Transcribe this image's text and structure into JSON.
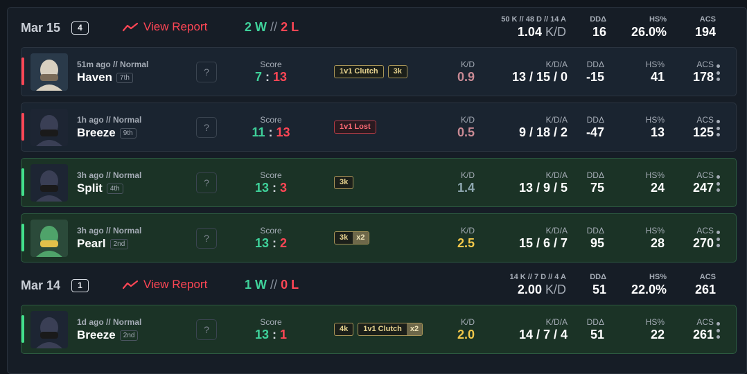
{
  "colors": {
    "win": "#3fd19a",
    "loss": "#ff4655",
    "neutral_kd": "#8ea7b0",
    "gold_kd": "#f2c84b",
    "bad_kd": "#c98a94"
  },
  "days": [
    {
      "date": "Mar 15",
      "count": "4",
      "view_report": "View Report",
      "wins": "2 W",
      "sep": "//",
      "losses": "2 L",
      "kda_summary": "50 K // 48 D // 14 A",
      "kd_value": "1.04",
      "kd_unit": "K/D",
      "dd_label": "DDΔ",
      "dd": "16",
      "hs_label": "HS%",
      "hs": "26.0%",
      "acs_label": "ACS",
      "acs": "194"
    },
    {
      "date": "Mar 14",
      "count": "1",
      "view_report": "View Report",
      "wins": "1 W",
      "sep": "//",
      "losses": "0 L",
      "kda_summary": "14 K // 7 D // 4 A",
      "kd_value": "2.00",
      "kd_unit": "K/D",
      "dd_label": "DDΔ",
      "dd": "51",
      "hs_label": "HS%",
      "hs": "22.0%",
      "acs_label": "ACS",
      "acs": "261"
    }
  ],
  "labels": {
    "score": "Score",
    "kd": "K/D",
    "kda": "K/D/A",
    "dd": "DDΔ",
    "hs": "HS%",
    "acs": "ACS",
    "question": "?"
  },
  "matches": [
    {
      "result": "loss",
      "agent_icon": "agent-portrait-icon",
      "ago": "51m ago // Normal",
      "map": "Haven",
      "place": "7th",
      "score_a": "7",
      "score_b": "13",
      "score_sep": ":",
      "tags": [
        {
          "text": "1v1 Clutch"
        },
        {
          "text": "3k"
        }
      ],
      "kd": "0.9",
      "kd_color": "#c98a94",
      "kda": "13 / 15 / 0",
      "dd": "-15",
      "hs": "41",
      "acs": "178"
    },
    {
      "result": "loss",
      "agent_icon": "agent-portrait-icon",
      "ago": "1h ago // Normal",
      "map": "Breeze",
      "place": "9th",
      "score_a": "11",
      "score_b": "13",
      "score_sep": ":",
      "tags": [
        {
          "text": "1v1 Lost",
          "lost": true
        }
      ],
      "kd": "0.5",
      "kd_color": "#c98a94",
      "kda": "9 / 18 / 2",
      "dd": "-47",
      "hs": "13",
      "acs": "125"
    },
    {
      "result": "win",
      "agent_icon": "agent-portrait-icon",
      "ago": "3h ago // Normal",
      "map": "Split",
      "place": "4th",
      "score_a": "13",
      "score_b": "3",
      "score_sep": ":",
      "tags": [
        {
          "text": "3k"
        }
      ],
      "kd": "1.4",
      "kd_color": "#8ea7b0",
      "kda": "13 / 9 / 5",
      "dd": "75",
      "hs": "24",
      "acs": "247"
    },
    {
      "result": "win",
      "agent_icon": "agent-portrait-icon",
      "ago": "3h ago // Normal",
      "map": "Pearl",
      "place": "2nd",
      "score_a": "13",
      "score_b": "2",
      "score_sep": ":",
      "tags": [
        {
          "text": "3k",
          "mult": "x2"
        }
      ],
      "kd": "2.5",
      "kd_color": "#f2c84b",
      "kda": "15 / 6 / 7",
      "dd": "95",
      "hs": "28",
      "acs": "270"
    },
    {
      "result": "win",
      "agent_icon": "agent-portrait-icon",
      "ago": "1d ago // Normal",
      "map": "Breeze",
      "place": "2nd",
      "score_a": "13",
      "score_b": "1",
      "score_sep": ":",
      "tags": [
        {
          "text": "4k"
        },
        {
          "text": "1v1 Clutch",
          "mult": "x2"
        }
      ],
      "kd": "2.0",
      "kd_color": "#f2c84b",
      "kda": "14 / 7 / 4",
      "dd": "51",
      "hs": "22",
      "acs": "261"
    }
  ]
}
